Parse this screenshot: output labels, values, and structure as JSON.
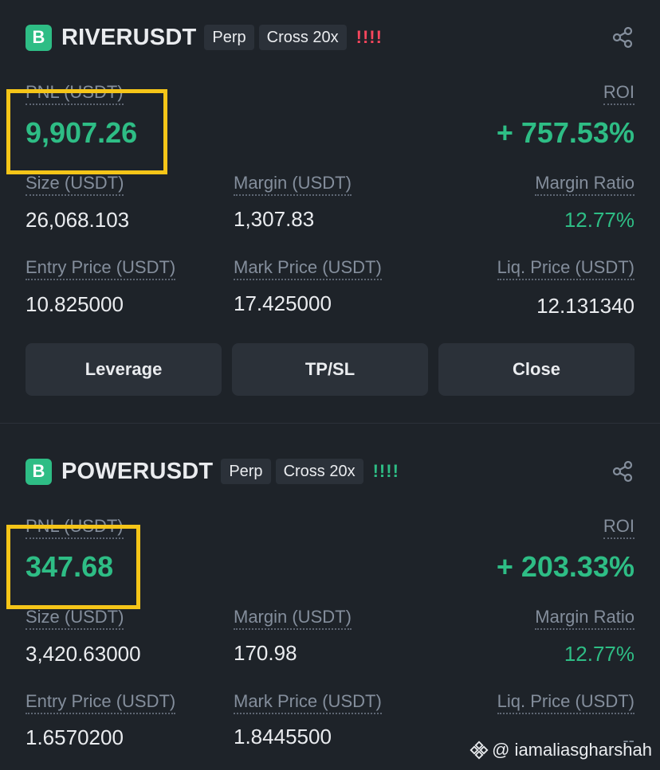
{
  "positions": [
    {
      "badge": "B",
      "symbol": "RIVERUSDT",
      "tags": [
        "Perp",
        "Cross 20x"
      ],
      "risk_bars": "!!!!",
      "pnl_label": "PNL (USDT)",
      "pnl_value": "9,907.26",
      "roi_label": "ROI",
      "roi_value": "+ 757.53%",
      "size_label": "Size (USDT)",
      "size_value": "26,068.103",
      "margin_label": "Margin (USDT)",
      "margin_value": "1,307.83",
      "margin_ratio_label": "Margin Ratio",
      "margin_ratio_value": "12.77%",
      "entry_label": "Entry Price (USDT)",
      "entry_value": "10.825000",
      "mark_label": "Mark Price (USDT)",
      "mark_value": "17.425000",
      "liq_label": "Liq. Price (USDT)",
      "liq_value": "12.131340",
      "buttons": [
        "Leverage",
        "TP/SL",
        "Close"
      ]
    },
    {
      "badge": "B",
      "symbol": "POWERUSDT",
      "tags": [
        "Perp",
        "Cross 20x"
      ],
      "risk_bars": "!!!!",
      "pnl_label": "PNL (USDT)",
      "pnl_value": "347.68",
      "roi_label": "ROI",
      "roi_value": "+ 203.33%",
      "size_label": "Size (USDT)",
      "size_value": "3,420.63000",
      "margin_label": "Margin (USDT)",
      "margin_value": "170.98",
      "margin_ratio_label": "Margin Ratio",
      "margin_ratio_value": "12.77%",
      "entry_label": "Entry Price (USDT)",
      "entry_value": "1.6570200",
      "mark_label": "Mark Price (USDT)",
      "mark_value": "1.8445500",
      "liq_label": "Liq. Price (USDT)",
      "liq_value": "--"
    }
  ],
  "watermark": "@ iamaliasgharshah",
  "colors": {
    "background": "#1e2329",
    "profit_green": "#2ebd85",
    "risk_red": "#f6465d",
    "highlight_yellow": "#f5c518",
    "button_bg": "#2b3139"
  },
  "icons": {
    "share": "share-icon",
    "watermark": "binance-diamond-icon"
  }
}
